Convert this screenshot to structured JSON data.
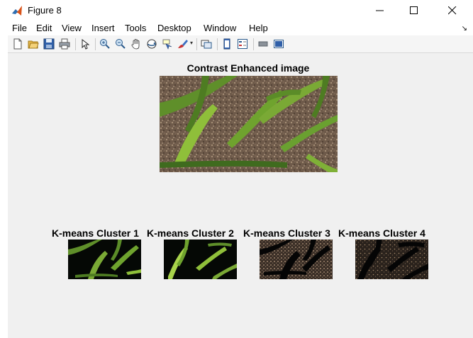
{
  "window": {
    "title": "Figure 8"
  },
  "menu": {
    "items": [
      "File",
      "Edit",
      "View",
      "Insert",
      "Tools",
      "Desktop",
      "Window",
      "Help"
    ]
  },
  "toolbar": {
    "icons": [
      "new-figure-icon",
      "open-file-icon",
      "save-icon",
      "print-icon",
      "edit-plot-arrow-icon",
      "zoom-in-icon",
      "zoom-out-icon",
      "pan-hand-icon",
      "rotate-3d-icon",
      "data-cursor-icon",
      "brush-icon",
      "link-plot-icon",
      "insert-colorbar-icon",
      "insert-legend-icon",
      "hide-plot-tools-icon",
      "show-plot-tools-icon"
    ]
  },
  "figure": {
    "main_title": "Contrast Enhanced image",
    "subplot_titles": [
      "K-means Cluster 1",
      "K-means Cluster 2",
      "K-means Cluster 3",
      "K-means Cluster 4"
    ]
  },
  "colors": {
    "matlab_orange": "#d95319",
    "leaf_green": "#6b9a2c",
    "soil_brown": "#6e5a4a"
  }
}
